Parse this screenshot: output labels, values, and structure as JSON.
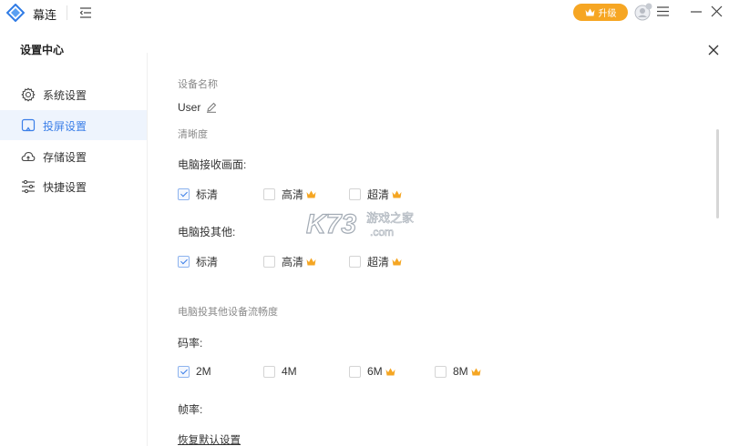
{
  "app": {
    "name": "幕连",
    "upgrade_label": "升级"
  },
  "panel": {
    "title": "设置中心"
  },
  "sidebar": {
    "items": [
      {
        "label": "系统设置",
        "icon": "gear-icon"
      },
      {
        "label": "投屏设置",
        "icon": "screen-cast-icon",
        "active": true
      },
      {
        "label": "存储设置",
        "icon": "cloud-icon"
      },
      {
        "label": "快捷设置",
        "icon": "sliders-icon"
      }
    ]
  },
  "main": {
    "device_section_title": "设备名称",
    "device_name": "User",
    "clarity_section_title": "清晰度",
    "receive_label": "电脑接收画面:",
    "receive_options": [
      {
        "label": "标清",
        "checked": true,
        "premium": false
      },
      {
        "label": "高清",
        "checked": false,
        "premium": true
      },
      {
        "label": "超清",
        "checked": false,
        "premium": true
      }
    ],
    "cast_label": "电脑投其他:",
    "cast_options": [
      {
        "label": "标清",
        "checked": true,
        "premium": false
      },
      {
        "label": "高清",
        "checked": false,
        "premium": true
      },
      {
        "label": "超清",
        "checked": false,
        "premium": true
      }
    ],
    "fluency_section_title": "电脑投其他设备流畅度",
    "bitrate_label": "码率:",
    "bitrate_options": [
      {
        "label": "2M",
        "checked": true,
        "premium": false
      },
      {
        "label": "4M",
        "checked": false,
        "premium": false
      },
      {
        "label": "6M",
        "checked": false,
        "premium": true
      },
      {
        "label": "8M",
        "checked": false,
        "premium": true
      }
    ],
    "framerate_label": "帧率:",
    "restore_label": "恢复默认设置"
  },
  "watermark": {
    "text": "K73",
    "sub1": "游戏之家",
    "sub2": ".com"
  },
  "colors": {
    "accent": "#3a7ee8",
    "upgrade": "#f6a623",
    "crown": "#f5a623",
    "active_bg": "#eef4fd"
  }
}
